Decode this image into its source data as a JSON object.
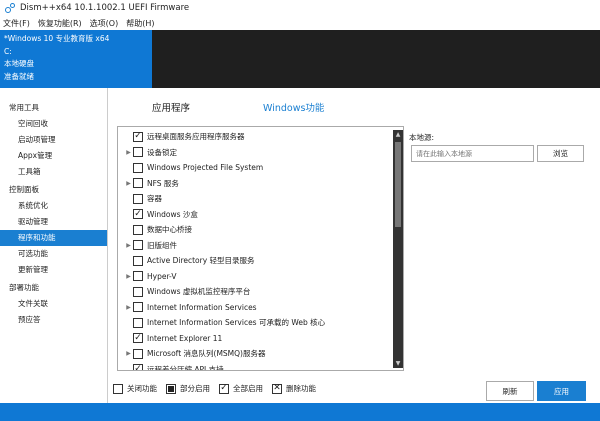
{
  "window": {
    "title": "Dism++x64 10.1.1002.1 UEFI Firmware"
  },
  "menu": [
    "文件(F)",
    "恢复功能(R)",
    "选项(O)",
    "帮助(H)"
  ],
  "header": {
    "os": "*Windows 10 专业教育版 x64",
    "drive": "C:",
    "disk": "本地硬盘",
    "status": "准备就绪"
  },
  "sidebar": [
    {
      "type": "group",
      "label": "常用工具"
    },
    {
      "type": "item",
      "label": "空间回收"
    },
    {
      "type": "item",
      "label": "启动项管理"
    },
    {
      "type": "item",
      "label": "Appx管理"
    },
    {
      "type": "item",
      "label": "工具箱"
    },
    {
      "type": "group",
      "label": "控制面板"
    },
    {
      "type": "item",
      "label": "系统优化"
    },
    {
      "type": "item",
      "label": "驱动管理"
    },
    {
      "type": "item",
      "label": "程序和功能",
      "active": true
    },
    {
      "type": "item",
      "label": "可选功能"
    },
    {
      "type": "item",
      "label": "更新管理"
    },
    {
      "type": "group",
      "label": "部署功能"
    },
    {
      "type": "item",
      "label": "文件关联"
    },
    {
      "type": "item",
      "label": "预应答"
    }
  ],
  "tabs": [
    {
      "label": "应用程序",
      "active": false
    },
    {
      "label": "Windows功能",
      "active": true
    }
  ],
  "features": [
    {
      "label": "远程桌面服务应用程序服务器",
      "checked": true,
      "expandable": false
    },
    {
      "label": "设备锁定",
      "checked": false,
      "expandable": true
    },
    {
      "label": "Windows Projected File System",
      "checked": false,
      "expandable": false
    },
    {
      "label": "NFS 服务",
      "checked": false,
      "expandable": true
    },
    {
      "label": "容器",
      "checked": false,
      "expandable": false
    },
    {
      "label": "Windows 沙盒",
      "checked": true,
      "expandable": false
    },
    {
      "label": "数据中心桥接",
      "checked": false,
      "expandable": false
    },
    {
      "label": "旧版组件",
      "checked": false,
      "expandable": true
    },
    {
      "label": "Active Directory 轻型目录服务",
      "checked": false,
      "expandable": false
    },
    {
      "label": "Hyper-V",
      "checked": false,
      "expandable": true
    },
    {
      "label": "Windows 虚拟机监控程序平台",
      "checked": false,
      "expandable": false
    },
    {
      "label": "Internet Information Services",
      "checked": false,
      "expandable": true
    },
    {
      "label": "Internet Information Services 可承载的 Web 核心",
      "checked": false,
      "expandable": false
    },
    {
      "label": "Internet Explorer 11",
      "checked": true,
      "expandable": false
    },
    {
      "label": "Microsoft 消息队列(MSMQ)服务器",
      "checked": false,
      "expandable": true
    },
    {
      "label": "远程差分压缩 API 支持",
      "checked": true,
      "expandable": false
    }
  ],
  "source": {
    "label": "本地源:",
    "placeholder": "请在此输入本地源",
    "browse": "浏览"
  },
  "legend": [
    {
      "icon": "empty",
      "label": "关闭功能"
    },
    {
      "icon": "partial",
      "label": "部分启用"
    },
    {
      "icon": "check",
      "label": "全部启用"
    },
    {
      "icon": "cross",
      "label": "删除功能"
    }
  ],
  "buttons": {
    "refresh": "刷新",
    "apply": "应用"
  },
  "colors": {
    "accent": "#0f78d4",
    "dark": "#1f1f1f"
  }
}
